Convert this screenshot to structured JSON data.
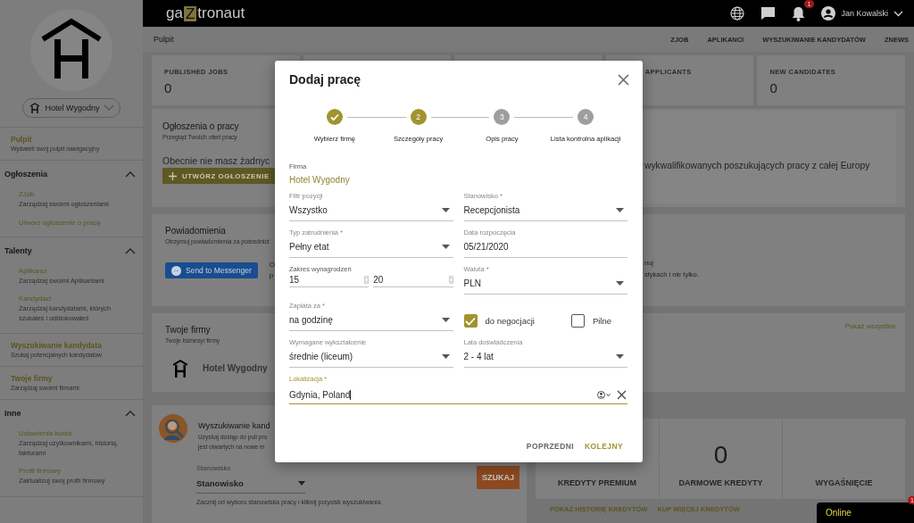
{
  "topbar": {
    "logo": [
      "ga",
      "Z",
      "tronaut"
    ],
    "notification_count": "1",
    "user": "Jan Kowalski"
  },
  "sidebar": {
    "company": "Hotel Wygodny",
    "nav": [
      {
        "kind": "link",
        "title": "Pulpit",
        "desc": "Wyświetl swój pulpit nawigacyjny"
      },
      {
        "kind": "group",
        "title": "Ogłoszenia",
        "expanded": true,
        "children": [
          {
            "title": "ZJob",
            "desc": "Zarządzaj swoimi ogłoszeniami"
          },
          {
            "title": "Utwórz ogłoszenie o pracę"
          }
        ]
      },
      {
        "kind": "group",
        "title": "Talenty",
        "expanded": true,
        "children": [
          {
            "title": "Aplikanci",
            "desc": "Zarządzaj swoimi Aplikantami"
          },
          {
            "title": "Kandydaci",
            "desc": "Zarządzaj kandydatami, których szukałeś i odblokowałeś"
          }
        ]
      },
      {
        "kind": "link",
        "title": "Wyszukiwanie kandydata",
        "desc": "Szukaj potencjalnych kandydatów"
      },
      {
        "kind": "link",
        "title": "Twoje firmy",
        "desc": "Zarządzaj swoimi firmami"
      },
      {
        "kind": "group",
        "title": "Inne",
        "expanded": true,
        "children": [
          {
            "title": "Ustawienia konta",
            "desc": "Zarządzaj użytkownikami, historią, fakturami"
          },
          {
            "title": "Profil firmowy",
            "desc": "Zaktualizuj swój profil firmowy"
          }
        ]
      }
    ]
  },
  "breadcrumb": "Pulpit",
  "nav_links": [
    "ZJOB",
    "APLIKANCI",
    "WYSZUKIWANIE KANDYDATÓW",
    "ZNEWS"
  ],
  "stats": [
    {
      "kind": "stat",
      "label": "PUBLISHED JOBS",
      "value": "0"
    },
    {
      "kind": "covered"
    },
    {
      "kind": "covered"
    },
    {
      "kind": "stat",
      "label": "APPLICANTS"
    },
    {
      "kind": "stat",
      "label": "NEW CANDIDATES",
      "value": "0"
    }
  ],
  "jobs_card": {
    "title": "Ogłoszenia o pracy",
    "subtitle": "Przegląd Twoich ofert pracy",
    "empty_text": "Obecnie nie masz żadnyc",
    "button": "UTWÓRZ OGŁOSZENIE",
    "right_text": "wykwalifikowanych poszukujących pracy z całej Europy"
  },
  "notifications_card": {
    "title": "Powiadomienia",
    "subtitle": "Otrzymuj powiadomienia za pośrednict",
    "button": "Send to Messenger",
    "left_fragments": [
      "O",
      "p"
    ],
    "right_lines": [
      "nuj",
      "stykach i nie tylko."
    ]
  },
  "companies_card": {
    "title": "Twoje firmy",
    "subtitle": "Twoje biznesy/ firmy",
    "company": "Hotel Wygodny",
    "show_all": "Pokaż wszystkie"
  },
  "search_card": {
    "title": "Wyszukiwanie kand",
    "lines": [
      "Uzyskaj dostęp do puli pro",
      "jest otwartych na nowe m"
    ],
    "field_label": "Stanowisko",
    "field_value": "Stanowisko",
    "button": "SZUKAJ",
    "hint": "Zacznij od wyboru stanowiska pracy i kliknij przycisk wyszukiwania"
  },
  "credits": {
    "cells": [
      {
        "label": "KREDYTY PREMIUM"
      },
      {
        "value": "0",
        "label": "DARMOWE KREDYTY"
      },
      {
        "label": "WYGAŚNIĘCIE"
      }
    ],
    "links": [
      "POKAŻ HISTORIĘ KREDYTÓW",
      "KUP WIĘCEJ KREDYTÓW"
    ]
  },
  "chat": {
    "status": "Online",
    "badge": "1"
  },
  "modal": {
    "title": "Dodaj pracę",
    "steps": [
      {
        "label": "Wybierz firmę",
        "completed": true,
        "selected": false
      },
      {
        "number": "2",
        "label": "Szczegóły pracy",
        "completed": false,
        "selected": true
      },
      {
        "number": "3",
        "label": "Opis pracy",
        "completed": false,
        "selected": false
      },
      {
        "number": "4",
        "label": "Lista kontrolna aplikacji",
        "completed": false,
        "selected": false
      }
    ],
    "fields": [
      {
        "kind": "static",
        "label": "Firma",
        "value": "Hotel Wygodny"
      },
      {
        "kind": "select",
        "label": "Filtr pozycji",
        "value": "Wszystko"
      },
      {
        "kind": "select",
        "label": "Stanowisko *",
        "value": "Recepcjonista"
      },
      {
        "kind": "select",
        "label": "Typ zatrudnienia *",
        "value": "Pełny etat"
      },
      {
        "kind": "text",
        "label": "Data rozpoczęcia",
        "value": "05/21/2020"
      },
      {
        "kind": "range",
        "label": "Zakres wynagrodzeń",
        "values": [
          "15",
          "20"
        ]
      },
      {
        "kind": "select",
        "label": "Waluta *",
        "value": "PLN"
      },
      {
        "kind": "select",
        "label": "Zapłata za *",
        "value": "na godzinę"
      },
      {
        "kind": "checks",
        "items": [
          {
            "label": "do negocjacji",
            "checked": true
          },
          {
            "label": "Pilne",
            "checked": false
          }
        ]
      },
      {
        "kind": "select",
        "label": "Wymagane wykształcenie",
        "value": "średnie (liceum)"
      },
      {
        "kind": "select",
        "label": "Lata doświadczenia",
        "value": "2 - 4 lat"
      },
      {
        "kind": "location",
        "label": "Lokalizacja *",
        "value": "Gdynia, Poland",
        "focused": true
      }
    ],
    "buttons": [
      {
        "label": "POPRZEDNI",
        "primary": false
      },
      {
        "label": "KOLEJNY",
        "primary": true
      }
    ]
  }
}
